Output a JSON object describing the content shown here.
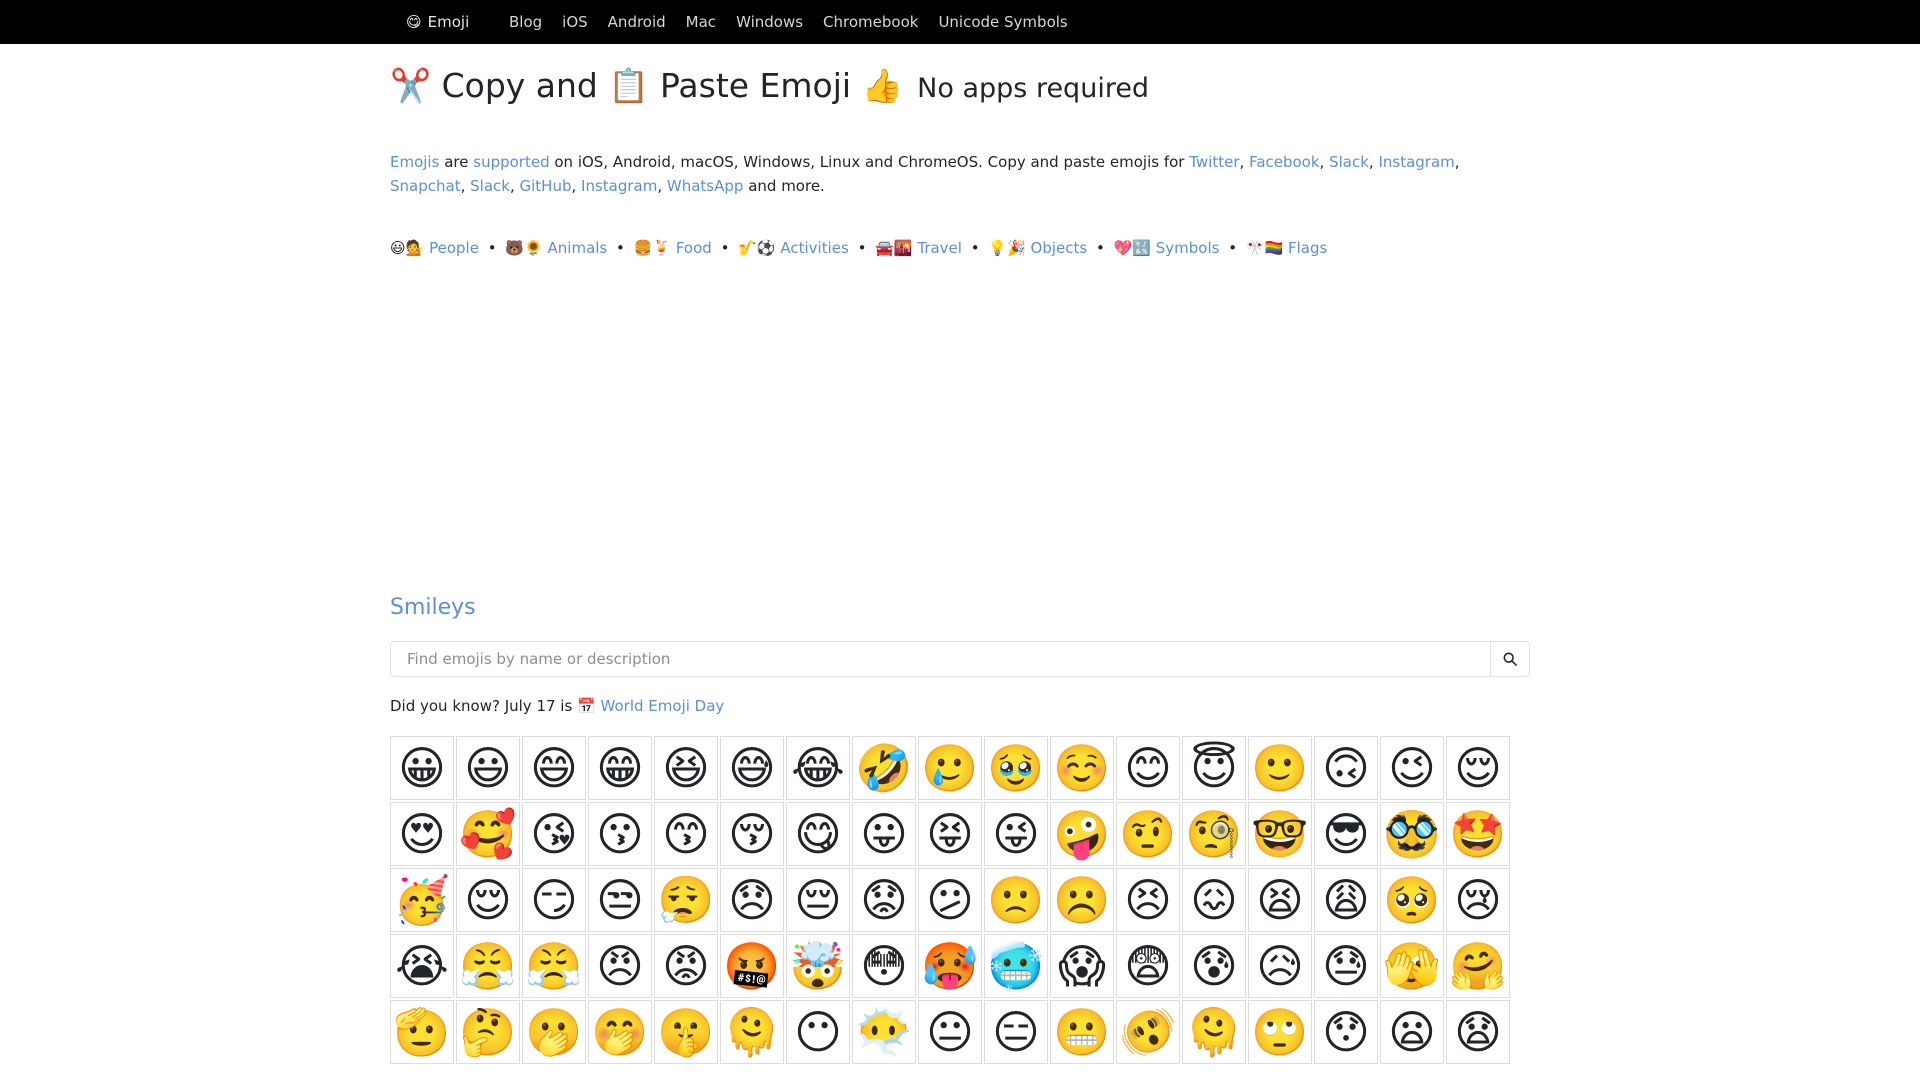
{
  "nav": {
    "brand_icon": "😋",
    "brand_label": "Emoji",
    "links": [
      "Blog",
      "iOS",
      "Android",
      "Mac",
      "Windows",
      "Chromebook",
      "Unicode Symbols"
    ]
  },
  "headline": {
    "scissors": "✂️",
    "copy": "Copy and",
    "clipboard": "📋",
    "paste": "Paste Emoji",
    "thumbs": "👍",
    "subtitle": "No apps required"
  },
  "intro": {
    "emojis_link": "Emojis",
    "are": "are",
    "supported_link": "supported",
    "text1": "on iOS, Android, macOS, Windows, Linux and ChromeOS. Copy and paste emojis for",
    "links1": [
      "Twitter",
      "Facebook",
      "Slack",
      "Instagram",
      "Snapchat",
      "Slack"
    ],
    "links2": [
      "GitHub",
      "Instagram",
      "WhatsApp"
    ],
    "text2": "and more."
  },
  "categories": [
    {
      "icons": "😃💁",
      "label": "People"
    },
    {
      "icons": "🐻🌻",
      "label": "Animals"
    },
    {
      "icons": "🍔🍹",
      "label": "Food"
    },
    {
      "icons": "🎷⚽",
      "label": "Activities"
    },
    {
      "icons": "🚘🌇",
      "label": "Travel"
    },
    {
      "icons": "💡🎉",
      "label": "Objects"
    },
    {
      "icons": "💖🔣",
      "label": "Symbols"
    },
    {
      "icons": "🎌🏳️‍🌈",
      "label": "Flags"
    }
  ],
  "category_separator": "•",
  "section_title": "Smileys",
  "search": {
    "placeholder": "Find emojis by name or description"
  },
  "did_you_know": {
    "text": "Did you know? July 17 is",
    "icon": "📅",
    "link": "World Emoji Day"
  },
  "emojis": [
    "😀",
    "😃",
    "😄",
    "😁",
    "😆",
    "😅",
    "😂",
    "🤣",
    "🥲",
    "🥹",
    "☺️",
    "😊",
    "😇",
    "🙂",
    "🙃",
    "😉",
    "😌",
    "😍",
    "🥰",
    "😘",
    "😗",
    "😙",
    "😚",
    "😋",
    "😛",
    "😝",
    "😜",
    "🤪",
    "🤨",
    "🧐",
    "🤓",
    "😎",
    "🥸",
    "🤩",
    "🥳",
    "😌",
    "😏",
    "😒",
    "😮‍💨",
    "😞",
    "😔",
    "😟",
    "😕",
    "🙁",
    "☹️",
    "😣",
    "😖",
    "😫",
    "😩",
    "🥺",
    "😢",
    "😭",
    "😤",
    "😤",
    "😠",
    "😡",
    "🤬",
    "🤯",
    "😳",
    "🥵",
    "🥶",
    "😱",
    "😨",
    "😰",
    "😥",
    "😓",
    "🫣",
    "🤗",
    "🫡",
    "🤔",
    "🫢",
    "🤭",
    "🤫",
    "🫠",
    "😶",
    "😶‍🌫️",
    "😐",
    "😑",
    "😬",
    "🫨",
    "🫠",
    "🙄",
    "😯",
    "😦",
    "😧"
  ]
}
